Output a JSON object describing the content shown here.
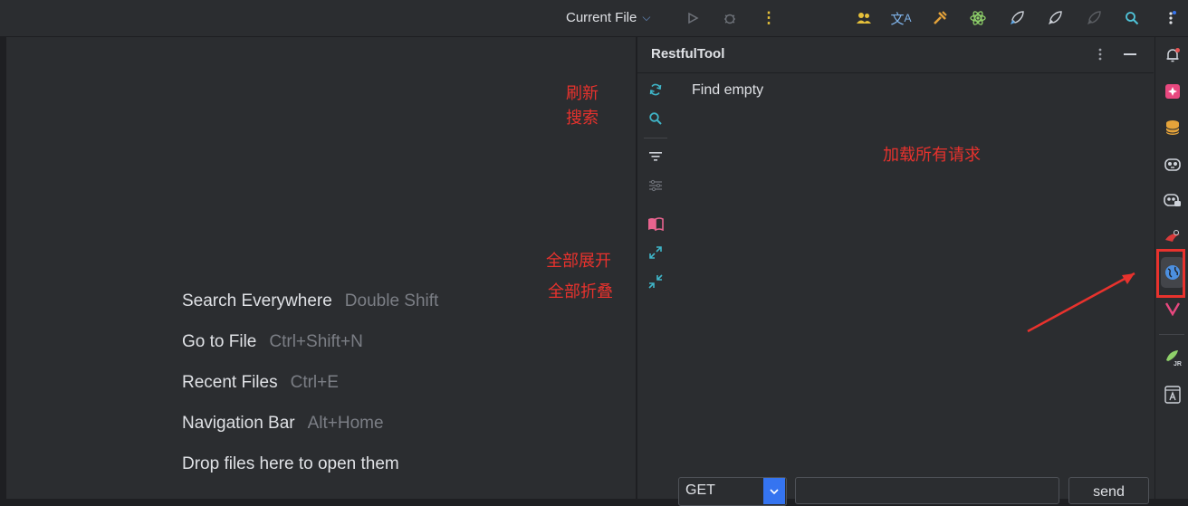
{
  "toolbar": {
    "run_config": "Current File",
    "icons": [
      "run-icon",
      "debug-icon",
      "more-vertical-icon",
      "users-icon",
      "translate-icon",
      "build-tools-icon",
      "atom-icon",
      "rocket-icon",
      "rocket-2-icon",
      "rocket-disabled-icon",
      "search-icon",
      "more-icon"
    ]
  },
  "editor": {
    "hints": [
      {
        "label": "Search Everywhere",
        "shortcut": "Double Shift"
      },
      {
        "label": "Go to File",
        "shortcut": "Ctrl+Shift+N"
      },
      {
        "label": "Recent Files",
        "shortcut": "Ctrl+E"
      },
      {
        "label": "Navigation Bar",
        "shortcut": "Alt+Home"
      },
      {
        "label": "Drop files here to open them",
        "shortcut": ""
      }
    ]
  },
  "tool_window": {
    "title": "RestfulTool",
    "tree_message": "Find empty",
    "method_value": "GET",
    "url_value": "",
    "send_label": "send"
  },
  "annotations": {
    "refresh": "刷新",
    "search": "搜索",
    "load_all": "加载所有请求",
    "expand_all": "全部展开",
    "collapse_all": "全部折叠"
  },
  "colors": {
    "accent": "#3574f0",
    "annotation": "#e8322d",
    "tool_icon": "#3fb5c8"
  }
}
